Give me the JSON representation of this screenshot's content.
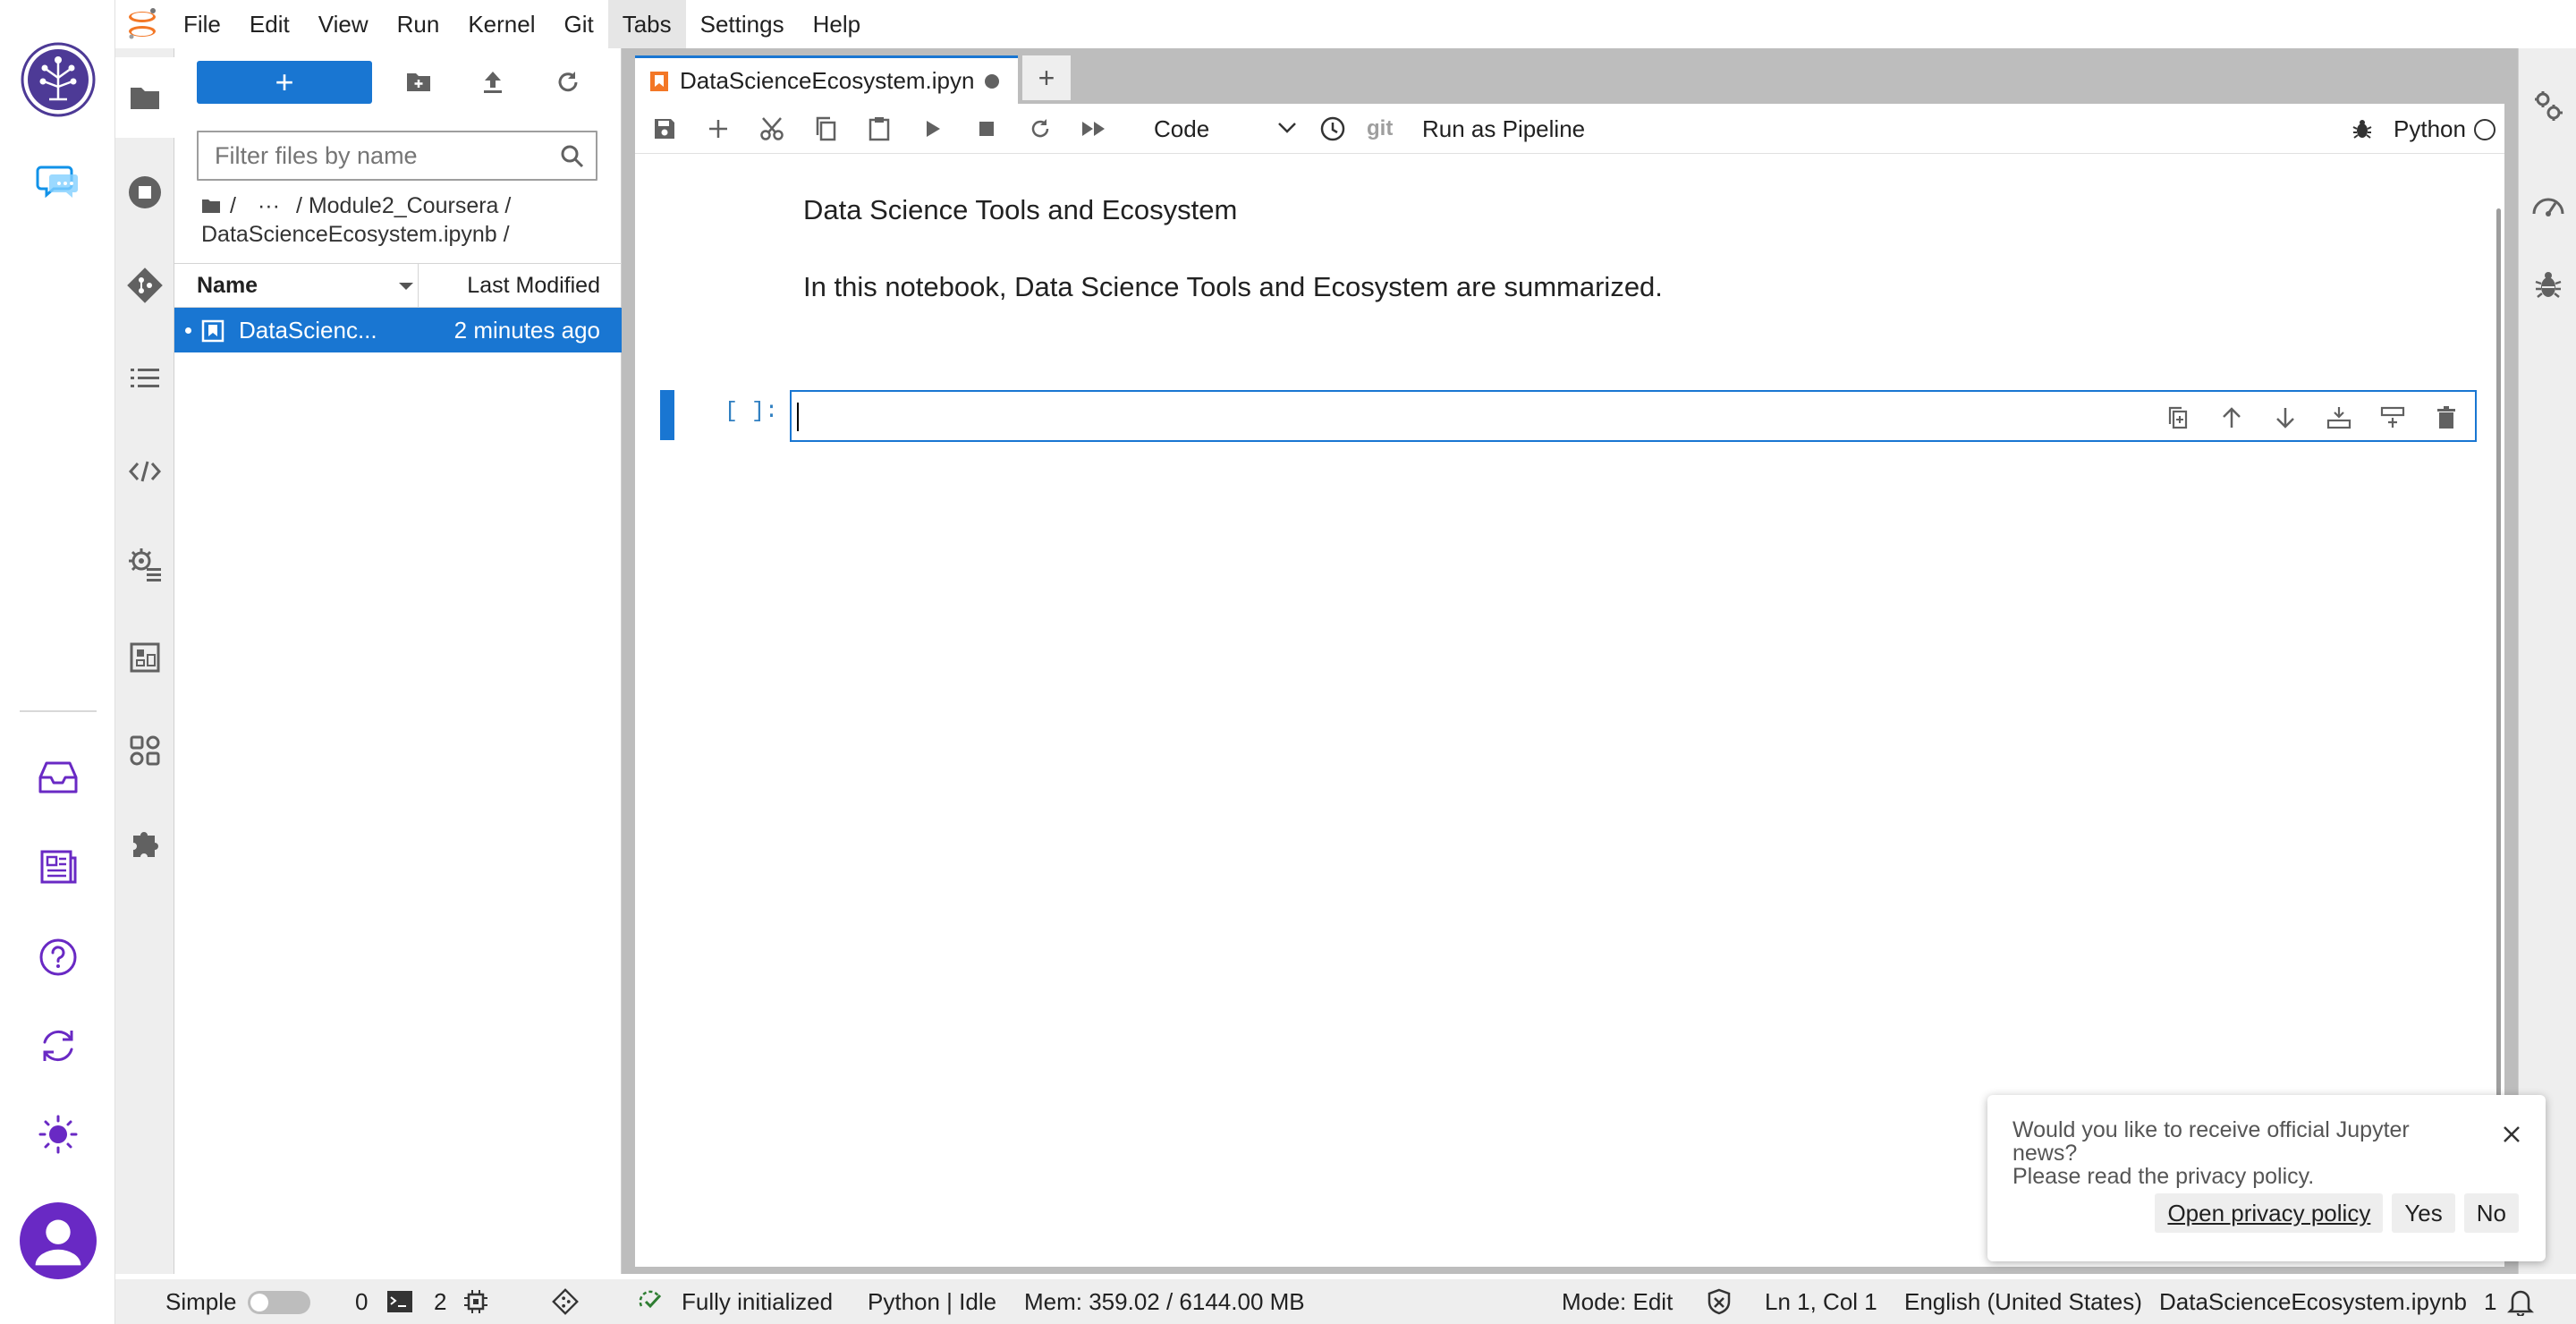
{
  "menu": {
    "items": [
      "File",
      "Edit",
      "View",
      "Run",
      "Kernel",
      "Git",
      "Tabs",
      "Settings",
      "Help"
    ],
    "active_item": "Tabs"
  },
  "left_rail": {
    "icons": [
      "ibm-logo-icon",
      "chat-icon",
      "inbox-icon",
      "news-icon",
      "help-icon",
      "sync-icon",
      "theme-icon",
      "user-avatar-icon"
    ]
  },
  "side_tabs": [
    "folder-icon",
    "running-icon",
    "git-icon",
    "toc-icon",
    "code-snippets-icon",
    "settings-icon",
    "variable-inspector-icon",
    "components-icon",
    "extensions-icon"
  ],
  "file_browser": {
    "new_button_label": "+",
    "filter_placeholder": "Filter files by name",
    "breadcrumb": {
      "root": "/",
      "ellipsis": "···",
      "folder": "/ Module2_Coursera /",
      "file": "DataScienceEcosystem.ipynb /"
    },
    "columns": {
      "name": "Name",
      "modified": "Last Modified"
    },
    "rows": [
      {
        "name": "DataScienc...",
        "modified": "2 minutes ago"
      }
    ]
  },
  "tabs": [
    {
      "title": "DataScienceEcosystem.ipyn",
      "dirty": true
    }
  ],
  "add_tab_label": "+",
  "notebook_toolbar": {
    "cell_type": "Code",
    "git_label": "git",
    "pipeline_label": "Run as Pipeline",
    "kernel_name": "Python"
  },
  "notebook": {
    "markdown_heading": "Data Science Tools and Ecosystem",
    "markdown_text": "In this notebook, Data Science Tools and Ecosystem are summarized.",
    "code_prompt": "[ ]:",
    "code_content": ""
  },
  "right_tabs": [
    "property-inspector-icon",
    "resource-usage-icon",
    "debugger-icon"
  ],
  "notification": {
    "message_line1": "Would you like to receive official Jupyter news?",
    "message_line2": "Please read the privacy policy.",
    "privacy_button": "Open privacy policy",
    "yes_button": "Yes",
    "no_button": "No"
  },
  "status_bar": {
    "mode_label": "Simple",
    "terminals_count": "0",
    "kernels_count": "2",
    "kernel_status": "Fully initialized",
    "kernel_info": "Python | Idle",
    "memory": "Mem: 359.02 / 6144.00 MB",
    "edit_mode": "Mode: Edit",
    "cursor_position": "Ln 1, Col 1",
    "language": "English (United States)",
    "filename": "DataScienceEcosystem.ipynb",
    "notification_count": "1"
  },
  "colors": {
    "accent": "#1976d2",
    "rail_purple": "#6929c4",
    "rail_teal": "#33b1ff",
    "icon_gray": "#616161"
  }
}
